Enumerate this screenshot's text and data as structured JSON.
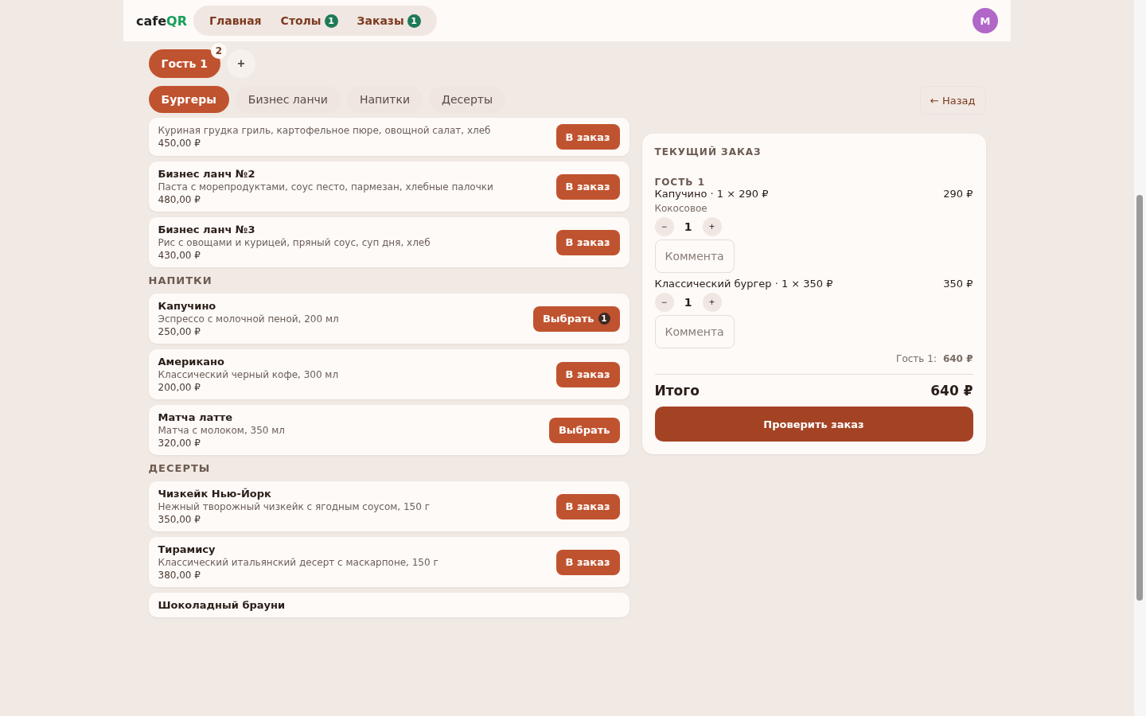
{
  "header": {
    "logo_dark": "cafe",
    "logo_accent": "QR",
    "nav": [
      {
        "label": "Главная"
      },
      {
        "label": "Столы",
        "badge": "1"
      },
      {
        "label": "Заказы",
        "badge": "1"
      }
    ],
    "avatar": "M"
  },
  "guests": {
    "tabs": [
      {
        "label": "Гость 1",
        "badge": "2",
        "selected": true
      }
    ],
    "add": "+"
  },
  "categories": [
    {
      "label": "Бургеры",
      "selected": true
    },
    {
      "label": "Бизнес ланчи",
      "selected": false
    },
    {
      "label": "Напитки",
      "selected": false
    },
    {
      "label": "Десерты",
      "selected": false
    }
  ],
  "back": "← Назад",
  "menu": [
    {
      "kind": "items",
      "items": [
        {
          "description": "Куриная грудка гриль, картофельное пюре, овощной салат, хлеб",
          "price": "450,00 ₽",
          "button": "В заказ"
        },
        {
          "title": "Бизнес ланч №2",
          "description": "Паста с морепродуктами, соус песто, пармезан, хлебные палочки",
          "price": "480,00 ₽",
          "button": "В заказ"
        },
        {
          "title": "Бизнес ланч №3",
          "description": "Рис с овощами и курицей, пряный соус, суп дня, хлеб",
          "price": "430,00 ₽",
          "button": "В заказ"
        }
      ]
    },
    {
      "kind": "section",
      "heading": "НАПИТКИ",
      "items": [
        {
          "title": "Капучино",
          "description": "Эспрессо с молочной пеной, 200 мл",
          "price": "250,00 ₽",
          "button": "Выбрать",
          "badge": "1"
        },
        {
          "title": "Американо",
          "description": "Классический черный кофе, 300 мл",
          "price": "200,00 ₽",
          "button": "В заказ"
        },
        {
          "title": "Матча латте",
          "description": "Матча с молоком, 350 мл",
          "price": "320,00 ₽",
          "button": "Выбрать"
        }
      ]
    },
    {
      "kind": "section",
      "heading": "ДЕСЕРТЫ",
      "items": [
        {
          "title": "Чизкейк Нью-Йорк",
          "description": "Нежный творожный чизкейк с ягодным соусом, 150 г",
          "price": "350,00 ₽",
          "button": "В заказ"
        },
        {
          "title": "Тирамису",
          "description": "Классический итальянский десерт с маскарпоне, 150 г",
          "price": "380,00 ₽",
          "button": "В заказ"
        },
        {
          "title": "Шоколадный брауни"
        }
      ]
    }
  ],
  "order": {
    "title": "ТЕКУЩИЙ ЗАКАЗ",
    "guest": "ГОСТЬ 1",
    "items": [
      {
        "line": "Капучино · 1 × 290 ₽",
        "amount": "290 ₽",
        "modifier": "Кокосовое",
        "minus": "−",
        "qty": "1",
        "plus": "+",
        "comment_placeholder": "Коммента"
      },
      {
        "line": "Классический бургер · 1 × 350 ₽",
        "amount": "350 ₽",
        "minus": "−",
        "qty": "1",
        "plus": "+",
        "comment_placeholder": "Коммента"
      }
    ],
    "subtotal_label": "Гость 1:",
    "subtotal": "640 ₽",
    "total_label": "Итого",
    "total": "640 ₽",
    "submit": "Проверить заказ"
  }
}
